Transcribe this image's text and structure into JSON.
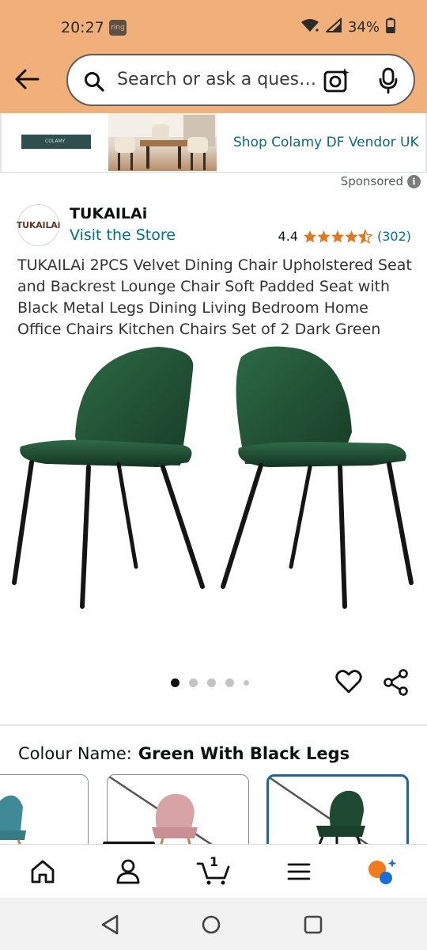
{
  "status_bar": {
    "time": "20:27",
    "app_badge": "ring",
    "battery": "34%"
  },
  "search": {
    "placeholder": "Search or ask a ques…"
  },
  "banner": {
    "logo_text": "COLAMY",
    "text": "Shop Colamy DF Vendor UK",
    "sponsored": "Sponsored"
  },
  "brand": {
    "logo_text": "TUKAILAi",
    "name": "TUKAILAi",
    "visit_store": "Visit the Store"
  },
  "rating": {
    "value": "4.4",
    "stars": 4.4,
    "count": "(302)"
  },
  "product": {
    "title": "TUKAILAi 2PCS Velvet Dining Chair Upholstered Seat and Backrest Lounge Chair Soft Padded Seat with Black Metal Legs Dining Living Bedroom Home Office Chairs Kitchen Chairs Set of 2 Dark Green"
  },
  "carousel": {
    "total": 5,
    "active": 0
  },
  "colour": {
    "label": "Colour Name:",
    "value": "Green With Black Legs"
  },
  "swatches": [
    {
      "name": "teal",
      "color": "#3f8a96"
    },
    {
      "name": "pink",
      "color": "#d6a4a6"
    },
    {
      "name": "dark green",
      "color": "#1e4a33",
      "selected": true
    }
  ],
  "nav": {
    "cart_count": "1",
    "items": [
      "home-icon",
      "account-icon",
      "cart-icon",
      "menu-icon",
      "rufus-icon"
    ]
  },
  "colors": {
    "header": "#f1b07a",
    "link": "#007185",
    "star": "#de7921",
    "selected": "#2162a1",
    "chair": "#1f4d32"
  }
}
